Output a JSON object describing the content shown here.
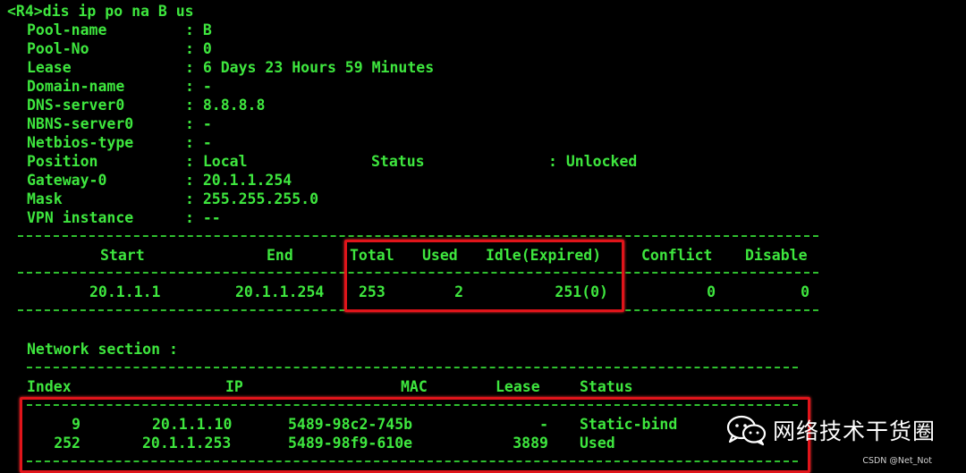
{
  "command": "<R4>dis ip po na B us",
  "fields": [
    {
      "key": "Pool-name",
      "value": ": B"
    },
    {
      "key": "Pool-No",
      "value": ": 0"
    },
    {
      "key": "Lease",
      "value": ": 6 Days 23 Hours 59 Minutes"
    },
    {
      "key": "Domain-name",
      "value": ": -"
    },
    {
      "key": "DNS-server0",
      "value": ": 8.8.8.8"
    },
    {
      "key": "NBNS-server0",
      "value": ": -"
    },
    {
      "key": "Netbios-type",
      "value": ": -"
    },
    {
      "key": "Position",
      "value": ": Local"
    },
    {
      "key": "Gateway-0",
      "value": ": 20.1.1.254"
    },
    {
      "key": "Mask",
      "value": ": 255.255.255.0"
    },
    {
      "key": "VPN instance",
      "value": ": --"
    }
  ],
  "status": {
    "label": "Status",
    "value": ": Unlocked"
  },
  "range_table": {
    "headers": {
      "start": "Start",
      "end": "End",
      "total": "Total",
      "used": "Used",
      "idle": "Idle(Expired)",
      "conflict": "Conflict",
      "disable": "Disable"
    },
    "row": {
      "start": "20.1.1.1",
      "end": "20.1.1.254",
      "total": "253",
      "used": "2",
      "idle": "251(0)",
      "conflict": "0",
      "disable": "0"
    }
  },
  "network_section": {
    "title": "Network section :",
    "headers": {
      "index": "Index",
      "ip": "IP",
      "mac": "MAC",
      "lease": "Lease",
      "status": "Status"
    },
    "rows": [
      {
        "index": "9",
        "ip": "20.1.1.10",
        "mac": "5489-98c2-745b",
        "lease": "-",
        "status": "Static-bind"
      },
      {
        "index": "252",
        "ip": "20.1.1.253",
        "mac": "5489-98f9-610e",
        "lease": "3889",
        "status": "Used"
      }
    ]
  },
  "watermark": {
    "text": "网络技术干货圈",
    "icon": "wechat-icon"
  },
  "credit": "CSDN @Net_Not",
  "colors": {
    "background": "#000000",
    "text": "#3ee63e",
    "highlight": "#e0141a",
    "watermark": "#ffffff"
  }
}
